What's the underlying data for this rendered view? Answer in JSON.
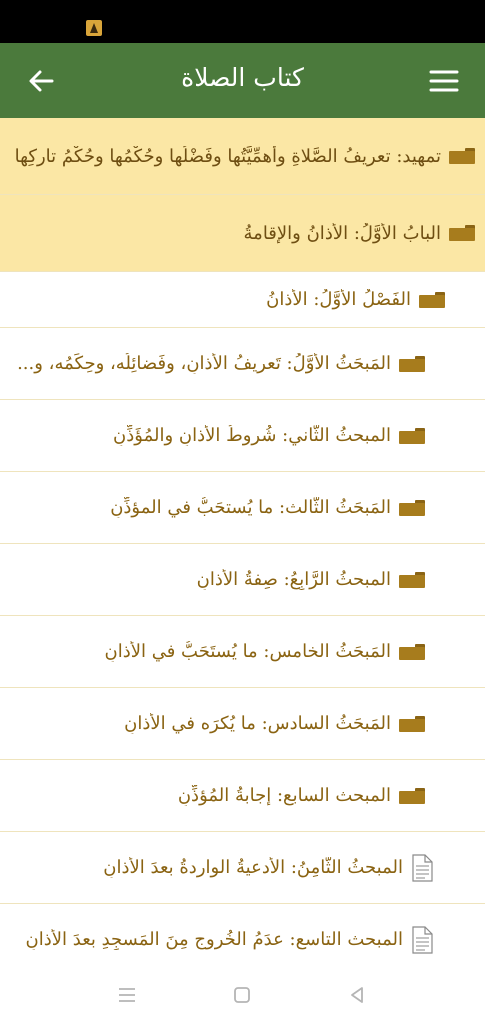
{
  "header": {
    "title": "كتاب الصلاة",
    "back_icon": "arrow-back-icon",
    "menu_icon": "hamburger-menu-icon",
    "color": "#4b7a3c"
  },
  "toc": {
    "items": [
      {
        "id": "intro",
        "level": 0,
        "icon": "folder-icon",
        "text": "تمهيد: تعريفُ الصَّلاةِ وأهمِّيَّتُها وفَضْلُها وحُكْمُها وحُكْمُ تاركِها"
      },
      {
        "id": "bab1",
        "level": 0,
        "icon": "folder-icon",
        "text": "البابُ الأوَّلُ: الأذانُ والإقامةُ"
      },
      {
        "id": "fasl1",
        "level": 1,
        "icon": "folder-icon",
        "text": "الفَصْلُ الأوَّلُ: الأذانُ"
      },
      {
        "id": "m1",
        "level": 2,
        "icon": "folder-icon",
        "text": "المَبحَثُ الأوَّلُ: تَعريفُ الأذانِ، وفَضائِلُه، وحِكَمُه، و..."
      },
      {
        "id": "m2",
        "level": 2,
        "icon": "folder-icon",
        "text": "المبحثُ الثَّاني: شُروطُ الأذانِ والمُؤَذِّنِ"
      },
      {
        "id": "m3",
        "level": 2,
        "icon": "folder-icon",
        "text": "المَبحَثُ الثَّالث: ما يُستحَبُّ في المؤذِّنِ"
      },
      {
        "id": "m4",
        "level": 2,
        "icon": "folder-icon",
        "text": "المبحثُ الرَّابِعُ: صِفةُ الأذانِ"
      },
      {
        "id": "m5",
        "level": 2,
        "icon": "folder-icon",
        "text": "المَبحَثُ الخامس: ما يُستَحَبُّ في الأذانِ"
      },
      {
        "id": "m6",
        "level": 2,
        "icon": "folder-icon",
        "text": "المَبحَثُ السادس: ما يُكرَه في الأذانِ"
      },
      {
        "id": "m7",
        "level": 2,
        "icon": "folder-icon",
        "text": "المبحث السابع: إجابةُ المُؤذِّنِ"
      },
      {
        "id": "m8",
        "level": 2,
        "icon": "document-icon",
        "text": "المبحثُ الثَّامِنُ: الأدعيةُ الواردةُ بعدَ الأذانِ"
      },
      {
        "id": "m9",
        "level": 2,
        "icon": "document-icon",
        "text": "المبحث التاسع: عدَمُ الخُروجِ مِنَ المَسجِدِ بعدَ الأذانِ"
      }
    ]
  },
  "system_nav": {
    "recents_icon": "recents-lines-icon",
    "home_icon": "home-square-icon",
    "back_icon": "back-triangle-icon"
  }
}
